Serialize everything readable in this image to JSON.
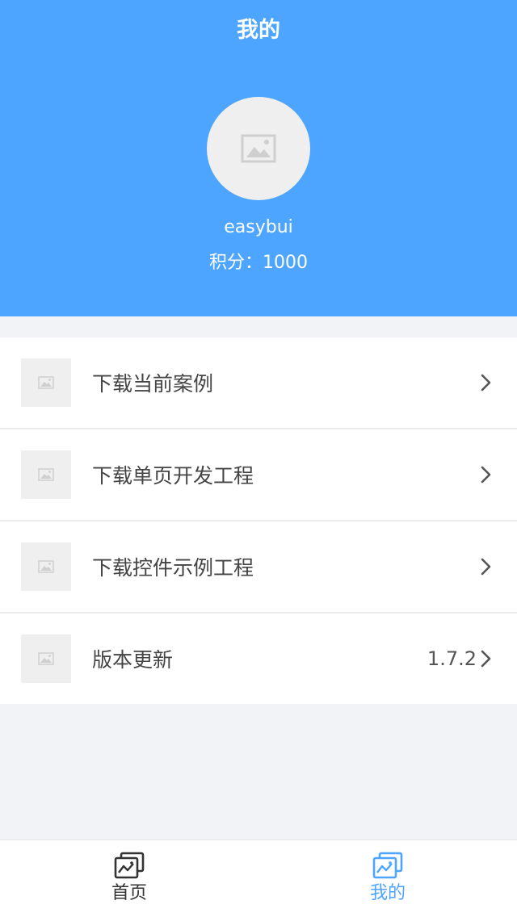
{
  "header": {
    "title": "我的",
    "username": "easybui",
    "points": "积分：1000",
    "bg_color": "#4da5ff"
  },
  "icons": {
    "avatar": "image-placeholder-icon",
    "list_thumb": "image-placeholder-icon",
    "chevron": "chevron-right-icon",
    "tab": "picture-frame-icon"
  },
  "list": {
    "items": [
      {
        "label": "下载当前案例",
        "value": ""
      },
      {
        "label": "下载单页开发工程",
        "value": ""
      },
      {
        "label": "下载控件示例工程",
        "value": ""
      },
      {
        "label": "版本更新",
        "value": "1.7.2"
      }
    ]
  },
  "tabbar": {
    "tabs": [
      {
        "label": "首页",
        "active": false
      },
      {
        "label": "我的",
        "active": true
      }
    ],
    "active_color": "#4da5ff"
  }
}
